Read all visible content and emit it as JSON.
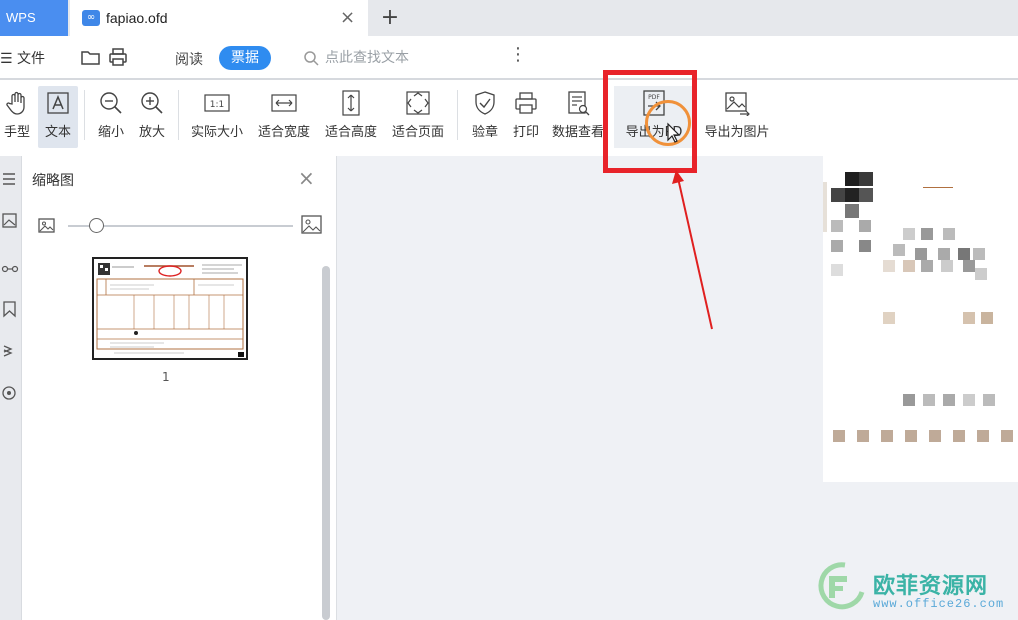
{
  "tabs": {
    "app": "WPS",
    "document": "fapiao.ofd",
    "close_glyph": "×",
    "add_glyph": "+"
  },
  "menubar": {
    "file_label": "文件",
    "read_label": "阅读",
    "invoice_label": "票据",
    "search_placeholder": "点此查找文本",
    "more_glyph": "⋮"
  },
  "toolbar": {
    "items": [
      {
        "label": "手型",
        "icon": "hand-icon"
      },
      {
        "label": "文本",
        "icon": "text-select-icon"
      },
      {
        "label": "缩小",
        "icon": "zoom-out-icon"
      },
      {
        "label": "放大",
        "icon": "zoom-in-icon"
      },
      {
        "label": "实际大小",
        "icon": "actual-size-icon",
        "icon_text": "1:1"
      },
      {
        "label": "适合宽度",
        "icon": "fit-width-icon"
      },
      {
        "label": "适合高度",
        "icon": "fit-height-icon"
      },
      {
        "label": "适合页面",
        "icon": "fit-page-icon"
      },
      {
        "label": "验章",
        "icon": "shield-check-icon"
      },
      {
        "label": "打印",
        "icon": "printer-icon"
      },
      {
        "label": "数据查看",
        "icon": "data-view-icon"
      },
      {
        "label": "导出为PDF",
        "label_visible": "导出为PD",
        "icon": "export-pdf-icon",
        "icon_text": "PDF"
      },
      {
        "label": "导出为图片",
        "icon": "export-image-icon"
      }
    ]
  },
  "sidebar": {
    "title": "缩略图",
    "close_glyph": "×",
    "page_number": "1"
  },
  "watermark": {
    "text": "欧菲资源网",
    "url": "www.office26.com"
  },
  "colors": {
    "accent": "#2f8cf0",
    "wps_tab": "#4a8ef0",
    "highlight_box": "#e8232a",
    "cursor_ring": "#f0913a",
    "arrow": "#e02020"
  }
}
